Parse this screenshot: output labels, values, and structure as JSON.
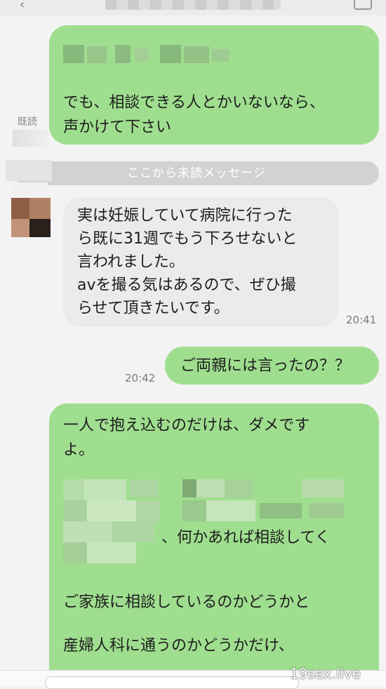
{
  "header": {
    "back_icon": "chevron-left-icon",
    "menu_icon": "menu-icon"
  },
  "messages": {
    "first_out": {
      "lines": [
        "でも、相談できる人とかいないなら、",
        "声かけて下さい"
      ],
      "read_label": "既読"
    },
    "unread_divider": "ここから未読メッセージ",
    "incoming": {
      "lines": [
        "実は妊娠していて病院に行った",
        "ら既に31週でもう下ろせないと",
        "言われました。",
        "avを撮る気はあるので、ぜひ撮",
        "らせて頂きたいです。"
      ],
      "time": "20:41"
    },
    "reply_out": {
      "text": "ご両親には言ったの？？",
      "time": "20:42"
    },
    "long_out": {
      "lines_top": [
        "一人で抱え込むのだけは、ダメです",
        "よ。"
      ],
      "line_partial": "、何かあれば相談してく",
      "line_family": "ご家族に相談しているのかどうかと",
      "line_clinic": "産婦人科に通うのかどうかだけ、"
    }
  },
  "watermark": "19sex.live",
  "colors": {
    "outgoing_bubble": "#9fde8f",
    "incoming_bubble": "#ebebeb",
    "divider": "#d2d2d2",
    "background": "#f3f3f4"
  }
}
